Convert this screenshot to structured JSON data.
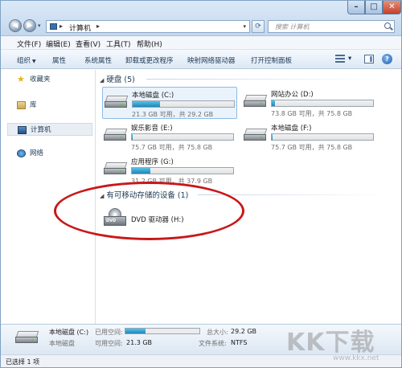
{
  "window": {
    "minimize": "–",
    "maximize": "□",
    "close": "✕"
  },
  "address": {
    "path": "计算机",
    "sep1": "▸",
    "sep2": "▸",
    "dropdown": "▾"
  },
  "search": {
    "placeholder": "搜索 计算机"
  },
  "menu": [
    "文件(F)",
    "编辑(E)",
    "查看(V)",
    "工具(T)",
    "帮助(H)"
  ],
  "commands": {
    "organize": "组织",
    "properties": "属性",
    "system_properties": "系统属性",
    "uninstall": "卸载或更改程序",
    "map_drive": "映射网络驱动器",
    "control_panel": "打开控制面板",
    "help": "?"
  },
  "nav": [
    "收藏夹",
    "库",
    "计算机",
    "网络"
  ],
  "groups": {
    "hdd": "硬盘 (5)",
    "removable": "有可移动存储的设备 (1)"
  },
  "drives": [
    {
      "name": "本地磁盘 (C:)",
      "free": "21.3 GB 可用，共 29.2 GB",
      "used": 0.27
    },
    {
      "name": "网站办公 (D:)",
      "free": "73.8 GB 可用，共 75.8 GB",
      "used": 0.03
    },
    {
      "name": "娱乐影音 (E:)",
      "free": "75.7 GB 可用，共 75.8 GB",
      "used": 0.01
    },
    {
      "name": "本地磁盘 (F:)",
      "free": "75.7 GB 可用，共 75.8 GB",
      "used": 0.01
    },
    {
      "name": "应用程序 (G:)",
      "free": "31.2 GB 可用，共 37.9 GB",
      "used": 0.18
    }
  ],
  "dvd": {
    "name": "DVD 驱动器 (H:)",
    "label": "DVD"
  },
  "details": {
    "name": "本地磁盘 (C:)",
    "type": "本地磁盘",
    "used_label": "已用空间:",
    "free_label": "可用空间:",
    "free_value": "21.3 GB",
    "total_label": "总大小:",
    "total_value": "29.2 GB",
    "fs_label": "文件系统:",
    "fs_value": "NTFS",
    "used": 0.27
  },
  "status": "已选择 1 项",
  "watermark": {
    "text": "KK下载",
    "url": "www.kkx.net"
  }
}
